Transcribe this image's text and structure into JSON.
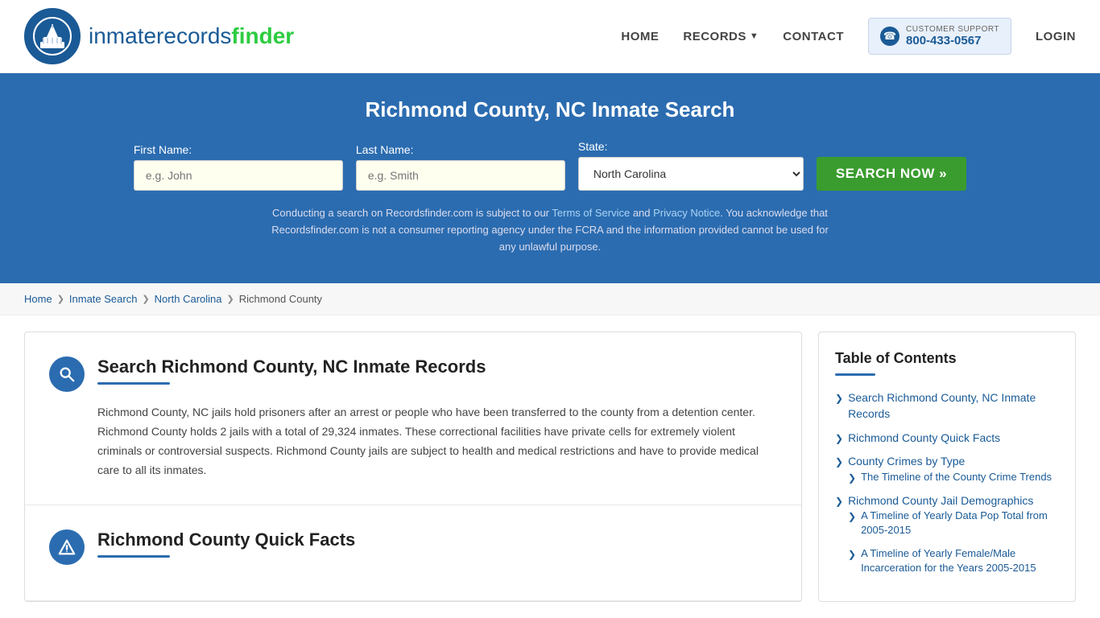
{
  "site": {
    "logo_text_part1": "inmaterecords",
    "logo_text_part2": "finder"
  },
  "nav": {
    "home": "HOME",
    "records": "RECORDS",
    "contact": "CONTACT",
    "support_label": "CUSTOMER SUPPORT",
    "support_number": "800-433-0567",
    "login": "LOGIN"
  },
  "hero": {
    "title": "Richmond County, NC Inmate Search",
    "first_name_label": "First Name:",
    "first_name_placeholder": "e.g. John",
    "last_name_label": "Last Name:",
    "last_name_placeholder": "e.g. Smith",
    "state_label": "State:",
    "state_value": "North Carolina",
    "search_button": "SEARCH NOW »",
    "disclaimer": "Conducting a search on Recordsfinder.com is subject to our Terms of Service and Privacy Notice. You acknowledge that Recordsfinder.com is not a consumer reporting agency under the FCRA and the information provided cannot be used for any unlawful purpose.",
    "tos_link": "Terms of Service",
    "privacy_link": "Privacy Notice"
  },
  "breadcrumb": {
    "home": "Home",
    "inmate_search": "Inmate Search",
    "state": "North Carolina",
    "county": "Richmond County"
  },
  "main_section": {
    "title": "Search Richmond County, NC Inmate Records",
    "body": "Richmond County, NC jails hold prisoners after an arrest or people who have been transferred to the county from a detention center. Richmond County holds 2 jails with a total of 29,324 inmates. These correctional facilities have private cells for extremely violent criminals or controversial suspects. Richmond County jails are subject to health and medical restrictions and have to provide medical care to all its inmates."
  },
  "quick_facts_section": {
    "title": "Richmond County Quick Facts"
  },
  "toc": {
    "title": "Table of Contents",
    "items": [
      {
        "label": "Search Richmond County, NC Inmate Records",
        "sub": false
      },
      {
        "label": "Richmond County Quick Facts",
        "sub": false
      },
      {
        "label": "County Crimes by Type",
        "sub": false
      },
      {
        "label": "The Timeline of the County Crime Trends",
        "sub": true,
        "parent": "County Crimes by Type"
      },
      {
        "label": "Richmond County Jail Demographics",
        "sub": false
      },
      {
        "label": "A Timeline of Yearly Data Pop Total from 2005-2015",
        "sub": true,
        "parent": "Richmond County Jail Demographics"
      },
      {
        "label": "A Timeline of Yearly Female/Male Incarceration for the Years 2005-2015",
        "sub": true,
        "parent": "Richmond County Jail Demographics"
      }
    ]
  }
}
